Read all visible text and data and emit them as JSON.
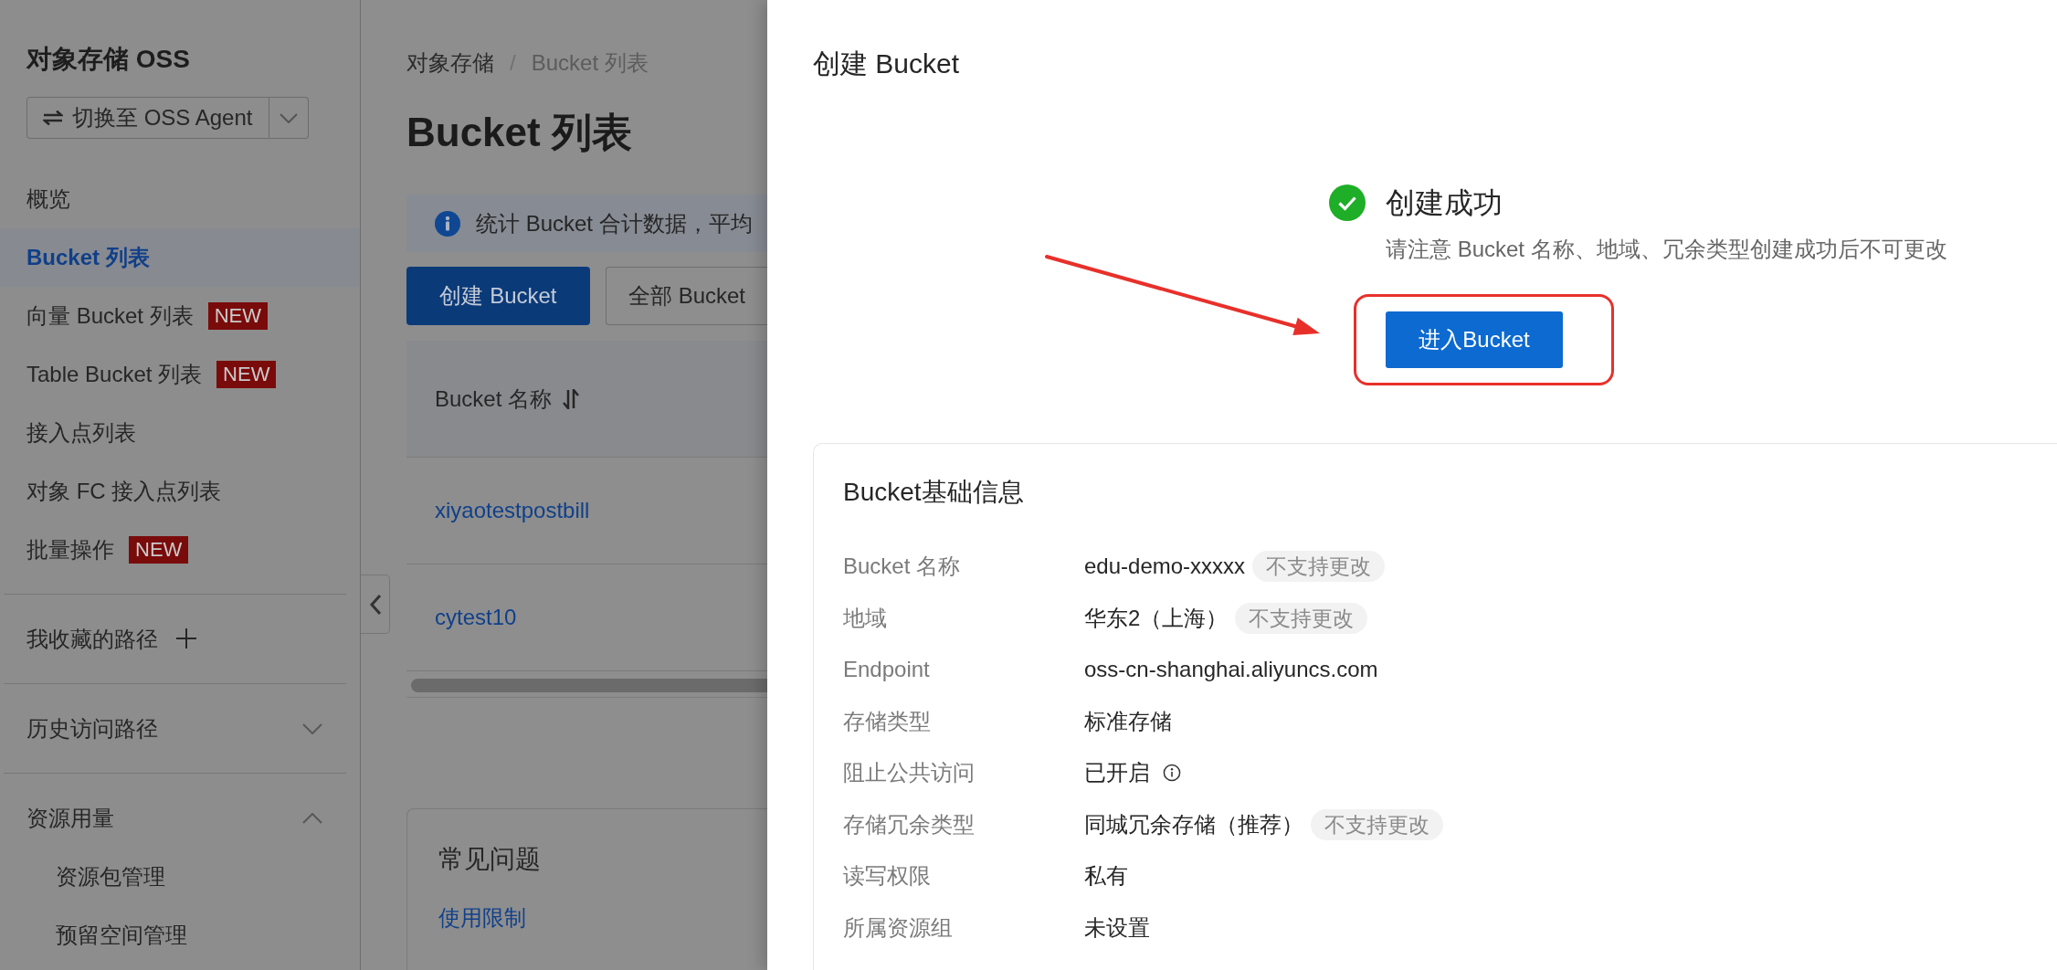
{
  "sidebar": {
    "title": "对象存储 OSS",
    "switch_button": {
      "label": "切换至 OSS Agent"
    },
    "items": [
      {
        "label": "概览",
        "selected": false
      },
      {
        "label": "Bucket 列表",
        "selected": true
      },
      {
        "label": "向量 Bucket 列表",
        "selected": false,
        "badge": "NEW"
      },
      {
        "label": "Table Bucket 列表",
        "selected": false,
        "badge": "NEW"
      },
      {
        "label": "接入点列表",
        "selected": false
      },
      {
        "label": "对象 FC 接入点列表",
        "selected": false
      },
      {
        "label": "批量操作",
        "selected": false,
        "badge": "NEW"
      }
    ],
    "sections": [
      {
        "kind": "addable",
        "label": "我收藏的路径"
      },
      {
        "kind": "collapsible",
        "label": "历史访问路径",
        "expanded": false
      },
      {
        "kind": "collapsible",
        "label": "资源用量",
        "expanded": true,
        "children": [
          {
            "label": "资源包管理",
            "selected": false
          },
          {
            "label": "预留空间管理",
            "selected": false
          }
        ]
      }
    ]
  },
  "main": {
    "breadcrumb": {
      "items": [
        "对象存储",
        "Bucket 列表"
      ],
      "separator": "/"
    },
    "title": "Bucket 列表",
    "notice": "统计 Bucket 合计数据，平均",
    "buttons": [
      {
        "kind": "primary",
        "label": "创建 Bucket"
      },
      {
        "kind": "default",
        "label": "全部 Bucket"
      }
    ],
    "table": {
      "columns": [
        "Bucket 名称"
      ],
      "rows": [
        [
          "xiyaotestpostbill"
        ],
        [
          "cytest10"
        ]
      ]
    },
    "faq": {
      "title": "常见问题",
      "links": [
        "使用限制"
      ]
    }
  },
  "drawer": {
    "title": "创建 Bucket",
    "result": {
      "kind": "success",
      "title": "创建成功",
      "message": "请注意 Bucket 名称、地域、冗余类型创建成功后不可更改",
      "button": {
        "label": "进入Bucket",
        "highlighted": true
      }
    },
    "info": {
      "title": "Bucket基础信息",
      "rows": [
        {
          "label": "Bucket 名称",
          "value": "edu-demo-xxxxx",
          "tag": "不支持更改",
          "info_tip": false
        },
        {
          "label": "地域",
          "value": "华东2（上海）",
          "tag": "不支持更改",
          "info_tip": false
        },
        {
          "label": "Endpoint",
          "value": "oss-cn-shanghai.aliyuncs.com",
          "info_tip": false
        },
        {
          "label": "存储类型",
          "value": "标准存储",
          "info_tip": false
        },
        {
          "label": "阻止公共访问",
          "value": "已开启",
          "info_tip": true
        },
        {
          "label": "存储冗余类型",
          "value": "同城冗余存储（推荐）",
          "tag": "不支持更改",
          "info_tip": false
        },
        {
          "label": "读写权限",
          "value": "私有",
          "info_tip": false
        },
        {
          "label": "所属资源组",
          "value": "未设置",
          "info_tip": false
        }
      ]
    }
  }
}
